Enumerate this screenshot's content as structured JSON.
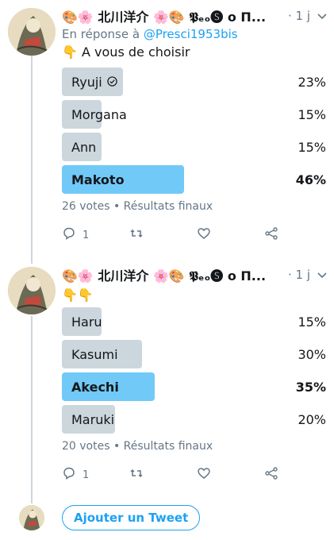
{
  "tweets": [
    {
      "author_name": "🎨🌸 北川洋介 🌸🎨 𝕻ₑₒ🅢 ο Π...",
      "time": "· 1 j",
      "reply_prefix": "En réponse à",
      "reply_handle": "@Presci1953bis",
      "text": "👇 A vous de choisir",
      "poll_options": [
        {
          "label": "Ryuji",
          "percent": "23%",
          "value": 23,
          "voted": true
        },
        {
          "label": "Morgana",
          "percent": "15%",
          "value": 15
        },
        {
          "label": "Ann",
          "percent": "15%",
          "value": 15
        },
        {
          "label": "Makoto",
          "percent": "46%",
          "value": 46,
          "winner": true
        }
      ],
      "poll_meta": "26 votes • Résultats finaux",
      "reply_count": "1"
    },
    {
      "author_name": "🎨🌸 北川洋介 🌸🎨 𝕻ₑₒ🅢 ο Π...",
      "time": "· 1 j",
      "text": "👇👇",
      "poll_options": [
        {
          "label": "Haru",
          "percent": "15%",
          "value": 15
        },
        {
          "label": "Kasumi",
          "percent": "30%",
          "value": 30
        },
        {
          "label": "Akechi",
          "percent": "35%",
          "value": 35,
          "winner": true
        },
        {
          "label": "Maruki",
          "percent": "20%",
          "value": 20
        }
      ],
      "poll_meta": "20 votes • Résultats finaux",
      "reply_count": "1"
    }
  ],
  "add_tweet_label": "Ajouter un Tweet",
  "colors": {
    "accent": "#1da1f2",
    "bar": "#ccd6dd",
    "winner_bar": "#71c9f8",
    "muted": "#657786"
  },
  "icons": [
    "reply-icon",
    "retweet-icon",
    "like-icon",
    "share-icon",
    "chevron-down-icon",
    "check-circle-icon"
  ]
}
